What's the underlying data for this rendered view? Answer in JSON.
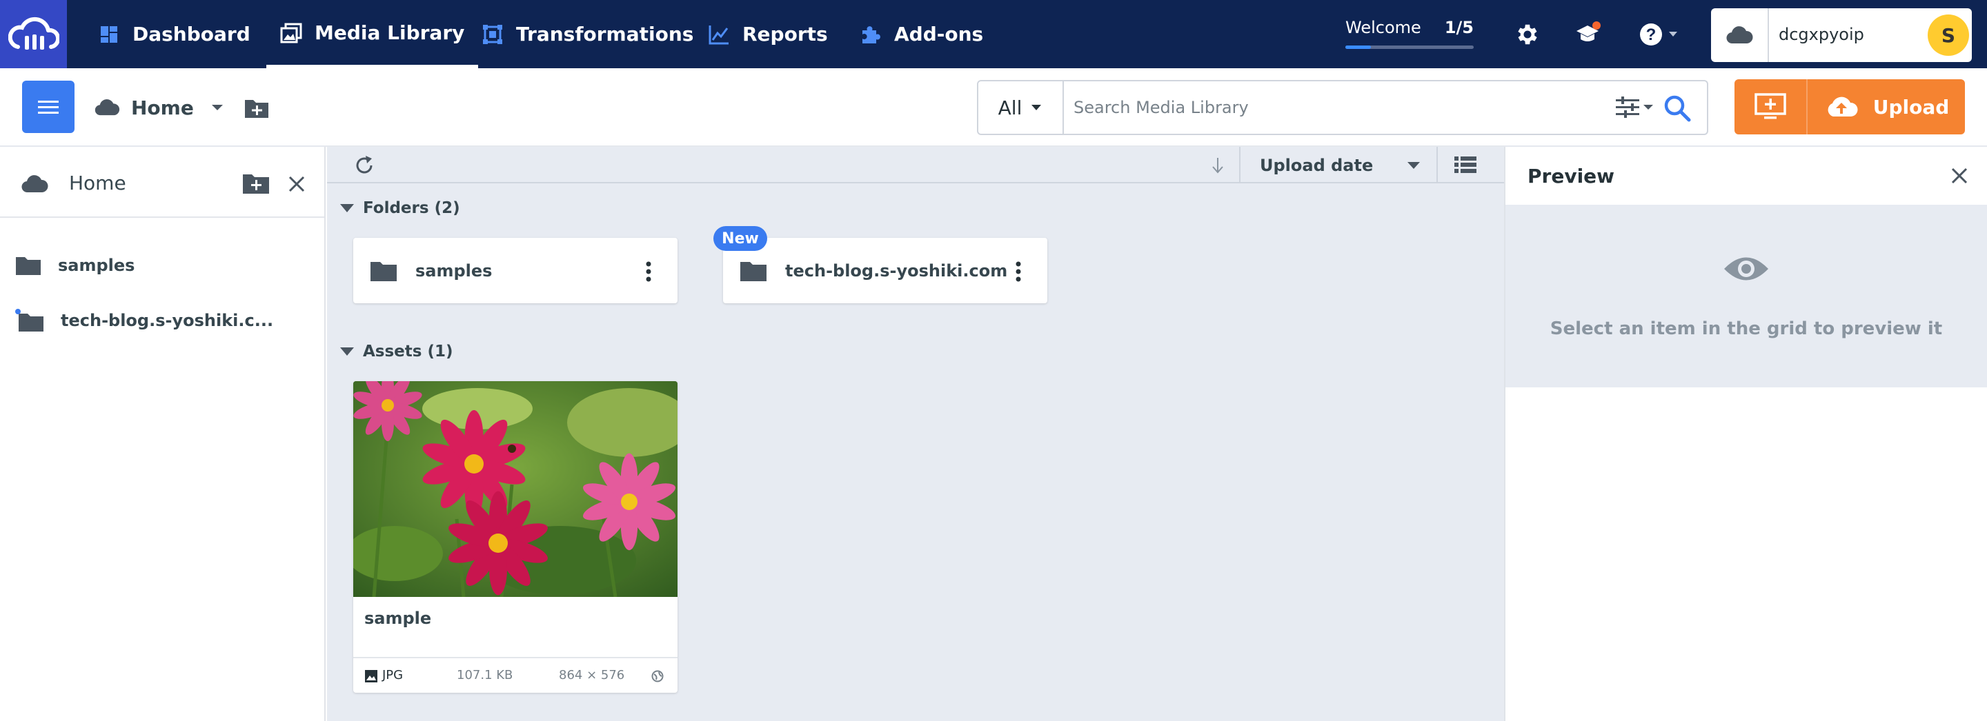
{
  "nav": {
    "items": [
      {
        "label": "Dashboard"
      },
      {
        "label": "Media Library"
      },
      {
        "label": "Transformations"
      },
      {
        "label": "Reports"
      },
      {
        "label": "Add-ons"
      }
    ],
    "welcome": {
      "label": "Welcome",
      "count": "1/5",
      "progress": 0.2
    },
    "account": {
      "name": "dcgxpyoip",
      "avatar_letter": "S"
    }
  },
  "toolbar": {
    "home_label": "Home",
    "search": {
      "filter": "All",
      "placeholder": "Search Media Library"
    },
    "upload_label": "Upload"
  },
  "left_panel": {
    "title": "Home",
    "items": [
      {
        "label": "samples",
        "new_dot": false
      },
      {
        "label": "tech-blog.s-yoshiki.c...",
        "new_dot": true
      }
    ]
  },
  "content": {
    "sort_label": "Upload date",
    "folders_header": "Folders (2)",
    "folders": [
      {
        "name": "samples"
      },
      {
        "name": "tech-blog.s-yoshiki.com",
        "badge": "New"
      }
    ],
    "assets_header": "Assets (1)",
    "assets": [
      {
        "title": "sample",
        "format": "JPG",
        "size": "107.1 KB",
        "dimensions": "864 × 576"
      }
    ]
  },
  "preview": {
    "title": "Preview",
    "empty_message": "Select an item in the grid to preview it"
  },
  "colors": {
    "nav_bg": "#0e2453",
    "logo_bg": "#3448c5",
    "accent_blue": "#3a7bf0",
    "upload_orange": "#f58331",
    "content_bg": "#e7ebf2"
  }
}
